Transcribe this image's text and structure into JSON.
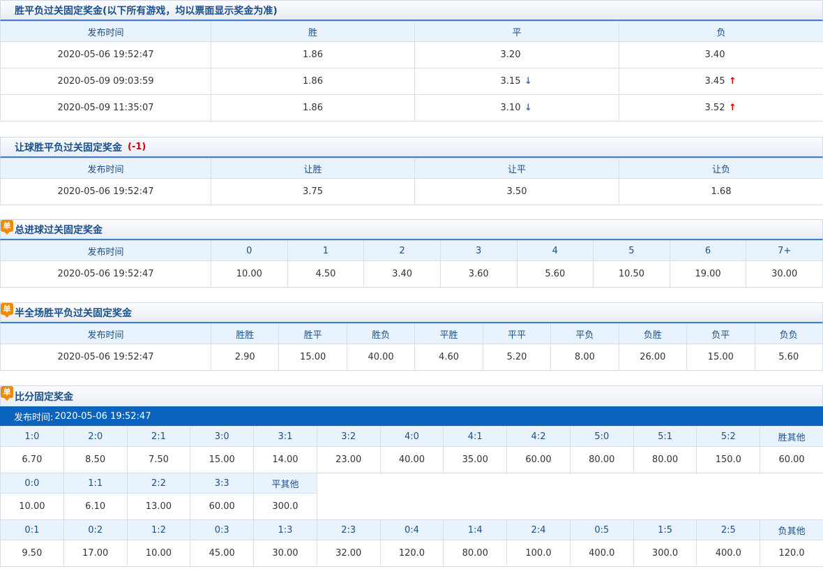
{
  "sec1": {
    "title": "胜平负过关固定奖金(以下所有游戏，均以票面显示奖金为准)",
    "headers": [
      "发布时间",
      "胜",
      "平",
      "负"
    ],
    "rows": [
      {
        "time": "2020-05-06 19:52:47",
        "win": "1.86",
        "draw": "3.20",
        "draw_trend": "",
        "lose": "3.40",
        "lose_trend": ""
      },
      {
        "time": "2020-05-09 09:03:59",
        "win": "1.86",
        "draw": "3.15",
        "draw_trend": "↓",
        "lose": "3.45",
        "lose_trend": "↑"
      },
      {
        "time": "2020-05-09 11:35:07",
        "win": "1.86",
        "draw": "3.10",
        "draw_trend": "↓",
        "lose": "3.52",
        "lose_trend": "↑"
      }
    ]
  },
  "sec2": {
    "title": "让球胜平负过关固定奖金",
    "handicap": "(-1)",
    "headers": [
      "发布时间",
      "让胜",
      "让平",
      "让负"
    ],
    "row": [
      "2020-05-06 19:52:47",
      "3.75",
      "3.50",
      "1.68"
    ]
  },
  "sec3": {
    "badge": "单",
    "title": "总进球过关固定奖金",
    "headers": [
      "发布时间",
      "0",
      "1",
      "2",
      "3",
      "4",
      "5",
      "6",
      "7+"
    ],
    "row": [
      "2020-05-06 19:52:47",
      "10.00",
      "4.50",
      "3.40",
      "3.60",
      "5.60",
      "10.50",
      "19.00",
      "30.00"
    ]
  },
  "sec4": {
    "badge": "单",
    "title": "半全场胜平负过关固定奖金",
    "headers": [
      "发布时间",
      "胜胜",
      "胜平",
      "胜负",
      "平胜",
      "平平",
      "平负",
      "负胜",
      "负平",
      "负负"
    ],
    "row": [
      "2020-05-06 19:52:47",
      "2.90",
      "15.00",
      "40.00",
      "4.60",
      "5.20",
      "8.00",
      "26.00",
      "15.00",
      "5.60"
    ]
  },
  "sec5": {
    "badge": "单",
    "title": "比分固定奖金",
    "time_label": "发布时间:",
    "time_value": "2020-05-06 19:52:47",
    "win_headers": [
      "1:0",
      "2:0",
      "2:1",
      "3:0",
      "3:1",
      "3:2",
      "4:0",
      "4:1",
      "4:2",
      "5:0",
      "5:1",
      "5:2",
      "胜其他"
    ],
    "win_values": [
      "6.70",
      "8.50",
      "7.50",
      "15.00",
      "14.00",
      "23.00",
      "40.00",
      "35.00",
      "60.00",
      "80.00",
      "80.00",
      "150.0",
      "60.00"
    ],
    "draw_headers": [
      "0:0",
      "1:1",
      "2:2",
      "3:3",
      "平其他"
    ],
    "draw_values": [
      "10.00",
      "6.10",
      "13.00",
      "60.00",
      "300.0"
    ],
    "lose_headers": [
      "0:1",
      "0:2",
      "1:2",
      "0:3",
      "1:3",
      "2:3",
      "0:4",
      "1:4",
      "2:4",
      "0:5",
      "1:5",
      "2:5",
      "负其他"
    ],
    "lose_values": [
      "9.50",
      "17.00",
      "10.00",
      "45.00",
      "30.00",
      "32.00",
      "120.0",
      "80.00",
      "100.0",
      "400.0",
      "300.0",
      "400.0",
      "120.0"
    ]
  }
}
